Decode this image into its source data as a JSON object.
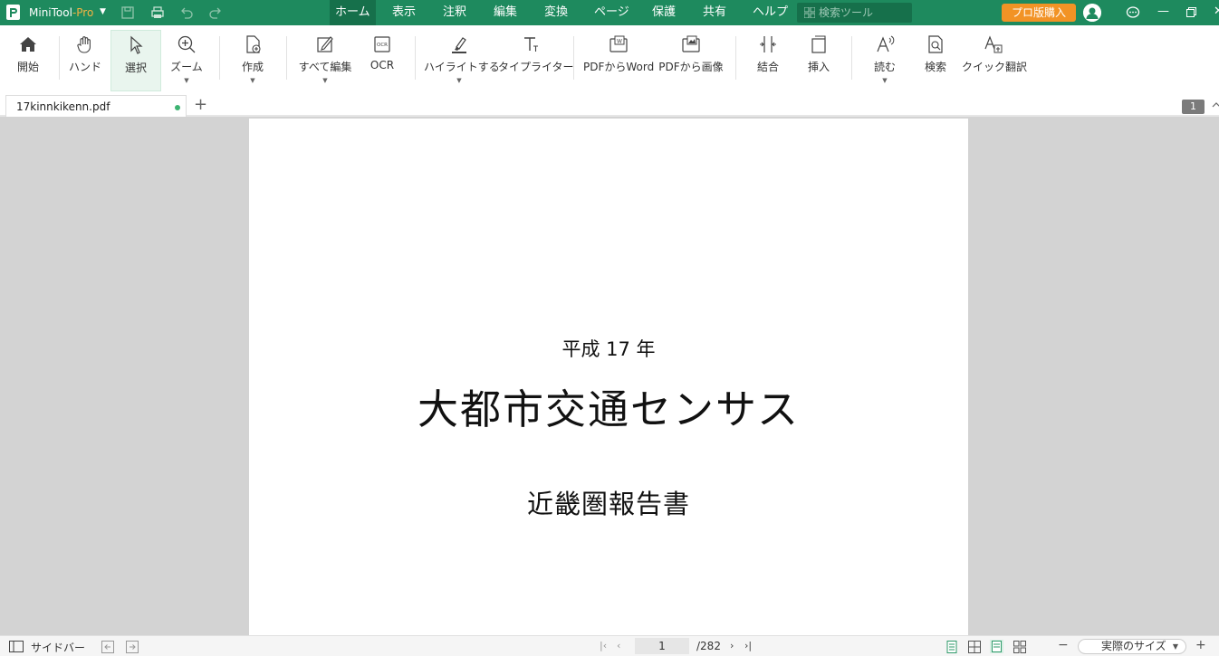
{
  "titlebar": {
    "app_name": "MiniTool",
    "app_edition": "-Pro",
    "menu": [
      "ホーム",
      "表示",
      "注釈",
      "編集",
      "変換",
      "ページ",
      "保護",
      "共有",
      "ヘルプ"
    ],
    "active_menu": "ホーム",
    "search_placeholder": "検索ツール",
    "buy_label": "プロ版購入"
  },
  "ribbon": {
    "start": "開始",
    "hand": "ハンド",
    "select": "選択",
    "zoom": "ズーム",
    "create": "作成",
    "edit_all": "すべて編集",
    "ocr": "OCR",
    "highlight": "ハイライトする",
    "typewriter": "タイプライター",
    "pdf_to_word": "PDFからWord",
    "pdf_to_image": "PDFから画像",
    "merge": "結合",
    "insert": "挿入",
    "read": "読む",
    "search": "検索",
    "quick_translate": "クイック翻訳"
  },
  "tabs": {
    "filename": "17kinnkikenn.pdf",
    "page_badge": "1"
  },
  "document": {
    "year": "平成 17 年",
    "title": "大都市交通センサス",
    "subtitle": "近畿圏報告書"
  },
  "statusbar": {
    "sidebar_label": "サイドバー",
    "current_page": "1",
    "total_pages": "/282",
    "fit_label": "実際のサイズ"
  }
}
